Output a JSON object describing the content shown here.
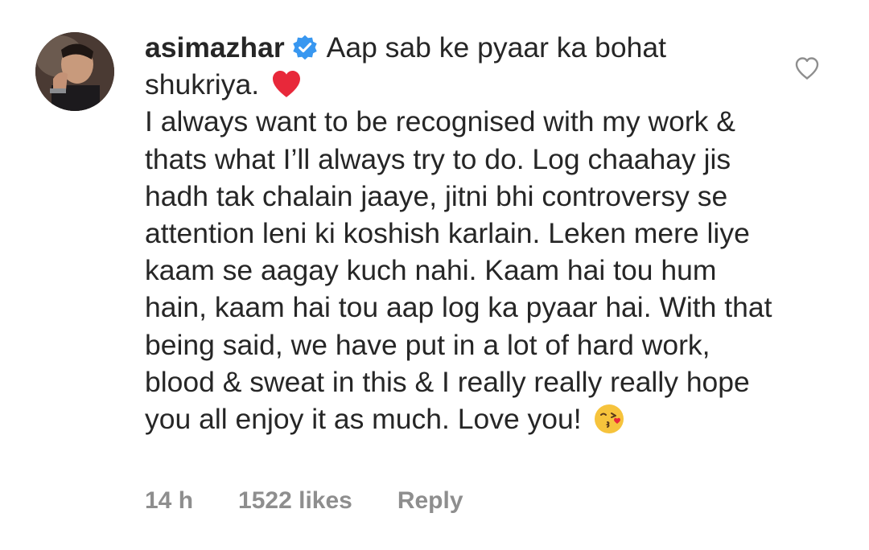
{
  "comment": {
    "username": "asimazhar",
    "verified_icon": "verified-badge-icon",
    "text_part1": "Aap sab ke pyaar ka bohat shukriya.",
    "emoji1": "red-heart-emoji",
    "text_part2": "I always want to be recognised with my work & thats what I’ll always try to do. Log chaahay jis hadh tak chalain jaaye, jitni bhi controversy se attention leni ki koshish karlain. Leken mere liye kaam se aagay kuch nahi. Kaam hai tou hum hain, kaam hai tou aap log ka pyaar hai. With that being said, we have put in a lot of hard work, blood & sweat in this & I really really really hope you all enjoy it as much. Love you!",
    "emoji2": "kissing-face-emoji",
    "time": "14 h",
    "likes": "1522 likes",
    "reply_label": "Reply",
    "like_icon": "heart-outline-icon"
  },
  "colors": {
    "text": "#262626",
    "meta": "#8e8e8e",
    "verified": "#3897f0",
    "heart_emoji": "#e8283a"
  }
}
